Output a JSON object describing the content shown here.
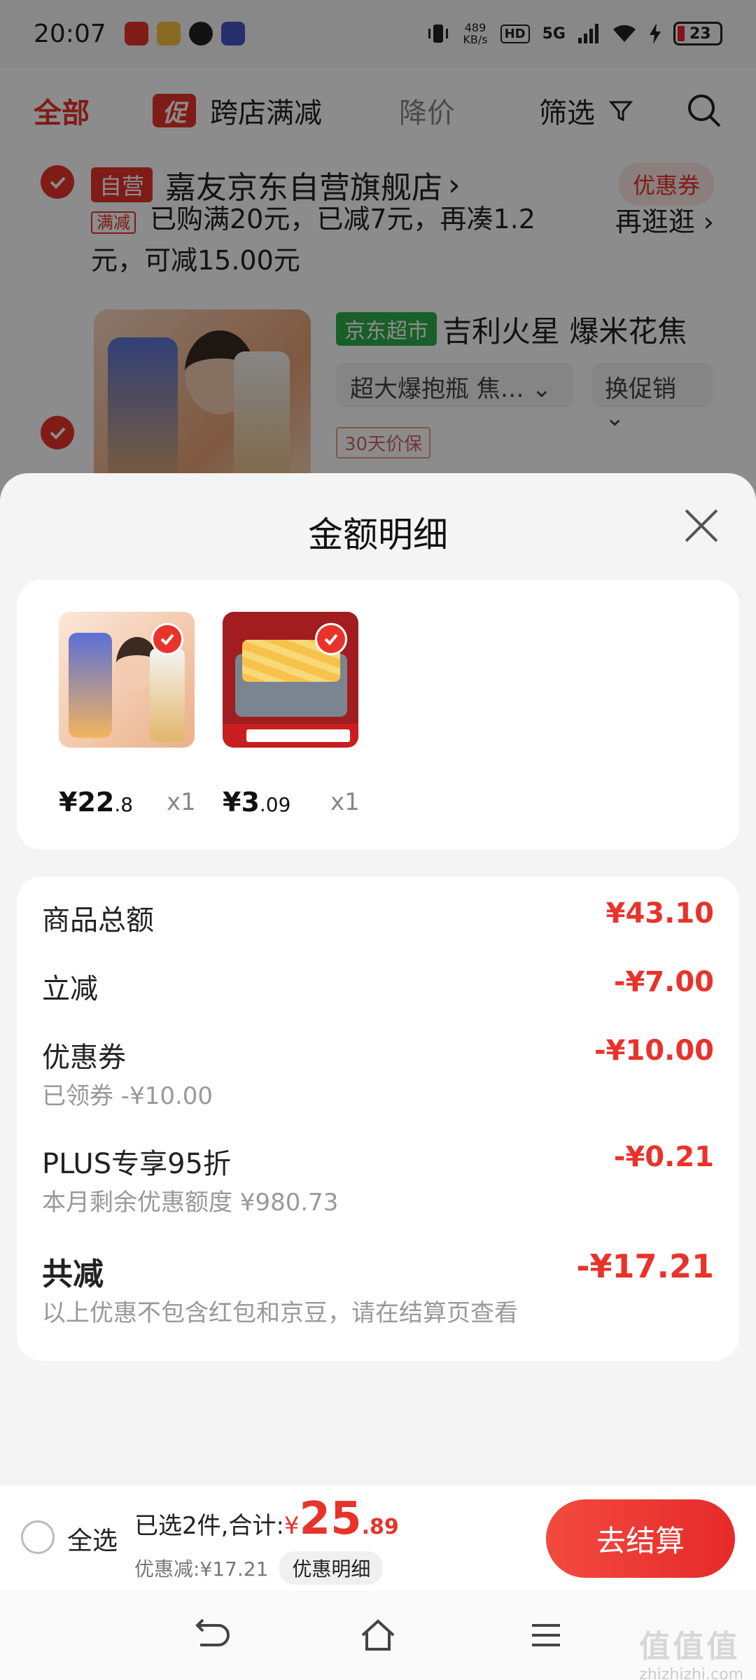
{
  "status_bar": {
    "time": "20:07",
    "net_speed_value": "489",
    "net_speed_unit": "KB/s",
    "hd": "HD",
    "network": "5G",
    "battery": "23"
  },
  "top_nav": {
    "all": "全部",
    "promo_tag": "促",
    "promo": "跨店满减",
    "price_drop": "降价",
    "filter": "筛选"
  },
  "shop": {
    "self_tag": "自营",
    "name": "嘉友京东自营旗舰店",
    "name_arrow": "›",
    "coupon": "优惠券",
    "full_tag": "满减",
    "promo_text": "已购满20元，已减7元，再凑1.2元，可减15.00元",
    "promo_go": "再逛逛 ›",
    "jd_tag": "京东超市",
    "product_title": "吉利火星 爆米花焦",
    "sku": "超大爆抱瓶 焦…",
    "sku_chevron": "⌄",
    "swap": "换促销",
    "swap_chevron": "⌄",
    "price_protect": "30天价保"
  },
  "sheet": {
    "title": "金额明细",
    "items": [
      {
        "price_int": "¥22",
        "price_dec": ".8",
        "qty": "x1"
      },
      {
        "price_int": "¥3",
        "price_dec": ".09",
        "qty": "x1"
      }
    ],
    "rows": {
      "total_label": "商品总额",
      "total_value": "¥43.10",
      "instant_label": "立减",
      "instant_value": "-¥7.00",
      "coupon_label": "优惠券",
      "coupon_value": "-¥10.00",
      "coupon_sub": "已领券 -¥10.00",
      "plus_label": "PLUS专享95折",
      "plus_value": "-¥0.21",
      "plus_sub": "本月剩余优惠额度 ¥980.73",
      "sum_label": "共减",
      "sum_value": "-¥17.21",
      "sum_sub": "以上优惠不包含红包和京豆，请在结算页查看"
    }
  },
  "action_bar": {
    "select_all": "全选",
    "selected_text": "已选2件,合计:",
    "currency": "¥",
    "total_int": "25",
    "total_dec": ".89",
    "discount_text": "优惠减:¥17.21",
    "detail_pill": "优惠明细",
    "checkout": "去结算"
  },
  "watermark": {
    "top": "值值值",
    "bottom": "zhizhizhi.com"
  }
}
